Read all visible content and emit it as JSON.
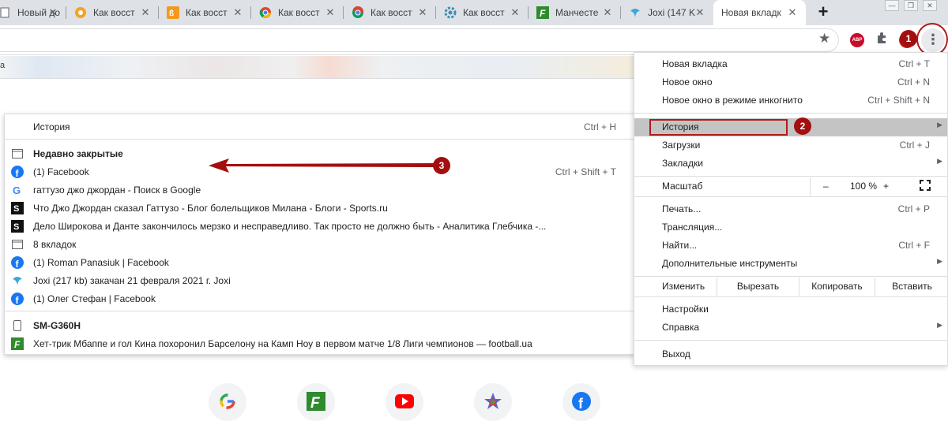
{
  "tabs": [
    {
      "title": "Новый до",
      "favicon": "blank-page-icon"
    },
    {
      "title": "Как восст",
      "favicon": "orange-icon"
    },
    {
      "title": "Как восст",
      "favicon": "rss-icon"
    },
    {
      "title": "Как восст",
      "favicon": "chrome-icon"
    },
    {
      "title": "Как восст",
      "favicon": "chrome-icon"
    },
    {
      "title": "Как восст",
      "favicon": "gear-icon"
    },
    {
      "title": "Манчесте",
      "favicon": "football-ua-icon"
    },
    {
      "title": "Joxi (147 K",
      "favicon": "joxi-icon"
    },
    {
      "title": "Новая вкладк",
      "favicon": "none",
      "active": true
    }
  ],
  "window_controls": {
    "minimize": "—",
    "maximize": "❐",
    "close": "✕"
  },
  "toolbar": {
    "star_icon": "★",
    "abp_label": "ABP",
    "menu_icon": "⋮"
  },
  "bookmark_bar": {
    "visible_text": "а"
  },
  "badges": {
    "one": "1",
    "two": "2",
    "three": "3"
  },
  "history_submenu": {
    "header": {
      "label": "История",
      "shortcut": "Ctrl + H"
    },
    "recently_closed": {
      "label": "Недавно закрытые"
    },
    "items": [
      {
        "label": "(1) Facebook",
        "shortcut": "Ctrl + Shift + T",
        "icon": "facebook-icon"
      },
      {
        "label": "гаттузо джо джордан - Поиск в Google",
        "shortcut": "",
        "icon": "google-icon"
      },
      {
        "label": "Что Джо Джордан сказал Гаттузо - Блог болельщиков Милана - Блоги - Sports.ru",
        "shortcut": "",
        "icon": "sports-ru-icon"
      },
      {
        "label": "Дело Широкова и Данте закончилось мерзко и несправедливо. Так просто не должно быть - Аналитика Глебчика -...",
        "shortcut": "",
        "icon": "sports-ru-icon"
      },
      {
        "label": "8 вкладок",
        "shortcut": "",
        "icon": "window-icon"
      },
      {
        "label": "(1) Roman Panasiuk | Facebook",
        "shortcut": "",
        "icon": "facebook-icon"
      },
      {
        "label": "Joxi (217 kb) закачан 21 февраля 2021 г. Joxi",
        "shortcut": "",
        "icon": "joxi-icon"
      },
      {
        "label": "(1) Олег Стефан | Facebook",
        "shortcut": "",
        "icon": "facebook-icon"
      }
    ],
    "device": {
      "label": "SM-G360H"
    },
    "device_items": [
      {
        "label": "Хет-трик Мбаппе и гол Кина похоронил Барселону на Камп Ноу в первом матче 1/8 Лиги чемпионов — football.ua",
        "icon": "football-ua-icon"
      }
    ]
  },
  "chrome_menu": {
    "new_tab": {
      "label": "Новая вкладка",
      "shortcut": "Ctrl + T"
    },
    "new_window": {
      "label": "Новое окно",
      "shortcut": "Ctrl + N"
    },
    "incognito": {
      "label": "Новое окно в режиме инкогнито",
      "shortcut": "Ctrl + Shift + N"
    },
    "history": {
      "label": "История"
    },
    "downloads": {
      "label": "Загрузки",
      "shortcut": "Ctrl + J"
    },
    "bookmarks": {
      "label": "Закладки"
    },
    "zoom": {
      "label": "Масштаб",
      "minus": "–",
      "value": "100 %",
      "plus": "+"
    },
    "print": {
      "label": "Печать...",
      "shortcut": "Ctrl + P"
    },
    "cast": {
      "label": "Трансляция..."
    },
    "find": {
      "label": "Найти...",
      "shortcut": "Ctrl + F"
    },
    "more_tools": {
      "label": "Дополнительные инструменты"
    },
    "edit": {
      "label": "Изменить",
      "cut": "Вырезать",
      "copy": "Копировать",
      "paste": "Вставить"
    },
    "settings": {
      "label": "Настройки"
    },
    "help": {
      "label": "Справка"
    },
    "exit": {
      "label": "Выход"
    },
    "submenu_arrow": "▶"
  },
  "shortcuts": [
    {
      "name": "google-shortcut",
      "icon": "google-icon"
    },
    {
      "name": "football-ua-shortcut",
      "icon": "football-ua-icon"
    },
    {
      "name": "youtube-shortcut",
      "icon": "youtube-icon"
    },
    {
      "name": "star-app-shortcut",
      "icon": "star-icon"
    },
    {
      "name": "facebook-shortcut",
      "icon": "facebook-icon"
    }
  ],
  "colors": {
    "annotation_red": "#a30e0e",
    "highlight_gray": "#c4c4c4",
    "facebook_blue": "#1877f2",
    "football_green": "#2e8b2e"
  }
}
